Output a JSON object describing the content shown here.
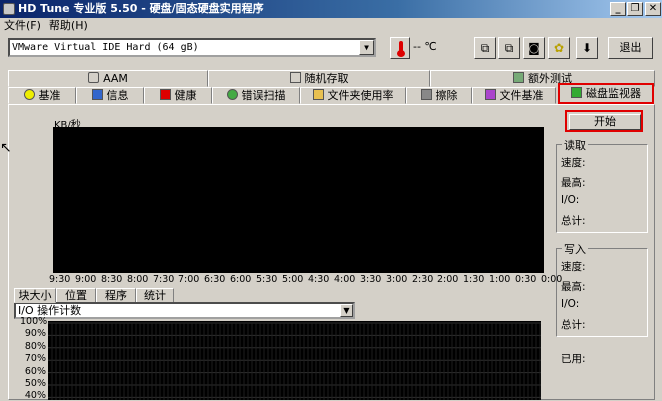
{
  "window": {
    "title": "HD Tune 专业版 5.50 - 硬盘/固态硬盘实用程序"
  },
  "menu": {
    "file": "文件(F)",
    "help": "帮助(H)"
  },
  "toolbar": {
    "drive": "VMware Virtual IDE Hard (64 gB)",
    "temperature": "-- ℃",
    "exit_label": "退出"
  },
  "tabs_top": [
    {
      "label": "AAM",
      "icon": "speaker-icon"
    },
    {
      "label": "随机存取",
      "icon": "random-access-icon"
    },
    {
      "label": "额外测试",
      "icon": "extra-tests-icon"
    }
  ],
  "tabs_bottom": [
    {
      "label": "基准",
      "icon": "benchmark-icon"
    },
    {
      "label": "信息",
      "icon": "info-icon"
    },
    {
      "label": "健康",
      "icon": "health-icon"
    },
    {
      "label": "错误扫描",
      "icon": "error-scan-icon"
    },
    {
      "label": "文件夹使用率",
      "icon": "folder-icon"
    },
    {
      "label": "擦除",
      "icon": "erase-icon"
    },
    {
      "label": "文件基准",
      "icon": "file-benchmark-icon"
    },
    {
      "label": "磁盘监视器",
      "icon": "disk-monitor-icon"
    }
  ],
  "monitor": {
    "start_label": "开始",
    "unit_label": "KB/秒",
    "read_group": {
      "title": "读取",
      "speed": "速度:",
      "max": "最高:",
      "io": "I/O:",
      "total": "总计:"
    },
    "write_group": {
      "title": "写入",
      "speed": "速度:",
      "max": "最高:",
      "io": "I/O:",
      "total": "总计:"
    },
    "used_label": "已用:",
    "sub_tabs": [
      "块大小",
      "位置",
      "程序",
      "统计"
    ],
    "io_select": "I/O 操作计数"
  },
  "chart_data": [
    {
      "type": "line",
      "ylabel": "KB/秒",
      "x": [
        "9:30",
        "9:00",
        "8:30",
        "8:00",
        "7:30",
        "7:00",
        "6:30",
        "6:00",
        "5:30",
        "5:00",
        "4:30",
        "4:00",
        "3:30",
        "3:00",
        "2:30",
        "2:00",
        "1:30",
        "1:00",
        "0:30",
        "0:00"
      ],
      "series": []
    },
    {
      "type": "bar",
      "y_ticks": [
        "100%",
        "90%",
        "80%",
        "70%",
        "60%",
        "50%",
        "40%"
      ],
      "series": []
    }
  ]
}
